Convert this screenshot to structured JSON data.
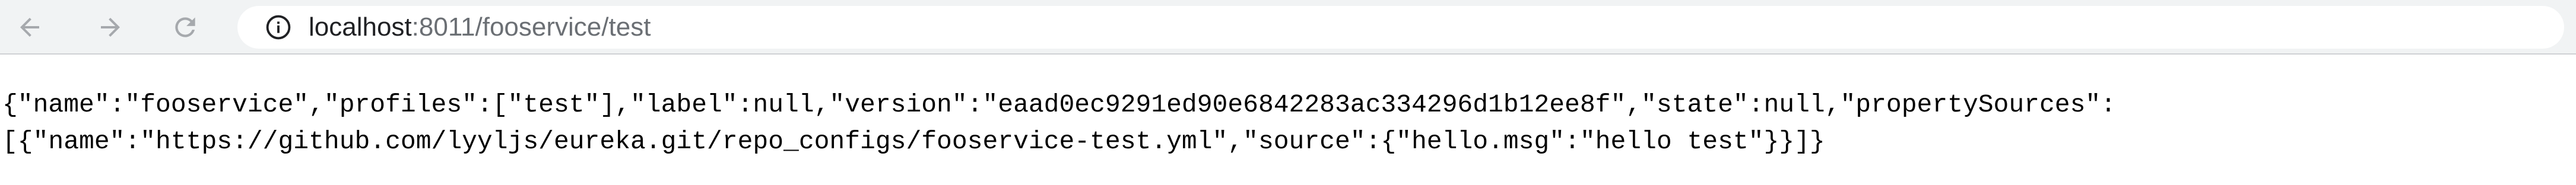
{
  "browser": {
    "toolbar": {
      "back_icon": "arrow-left-icon",
      "forward_icon": "arrow-right-icon",
      "reload_icon": "reload-icon"
    },
    "address_bar": {
      "icon": "info-icon",
      "host": "localhost",
      "rest": ":8011/fooservice/test"
    }
  },
  "page": {
    "lines": [
      "{\"name\":\"fooservice\",\"profiles\":[\"test\"],\"label\":null,\"version\":\"eaad0ec9291ed90e6842283ac334296d1b12ee8f\",\"state\":null,\"propertySources\":",
      "[{\"name\":\"https://github.com/lyyljs/eureka.git/repo_configs/fooservice-test.yml\",\"source\":{\"hello.msg\":\"hello test\"}}]}"
    ]
  },
  "colors": {
    "toolbar_bg": "#f1f3f4",
    "icon_color": "#a6a9ad",
    "url_host": "#202124",
    "url_rest": "#6b6f74"
  }
}
